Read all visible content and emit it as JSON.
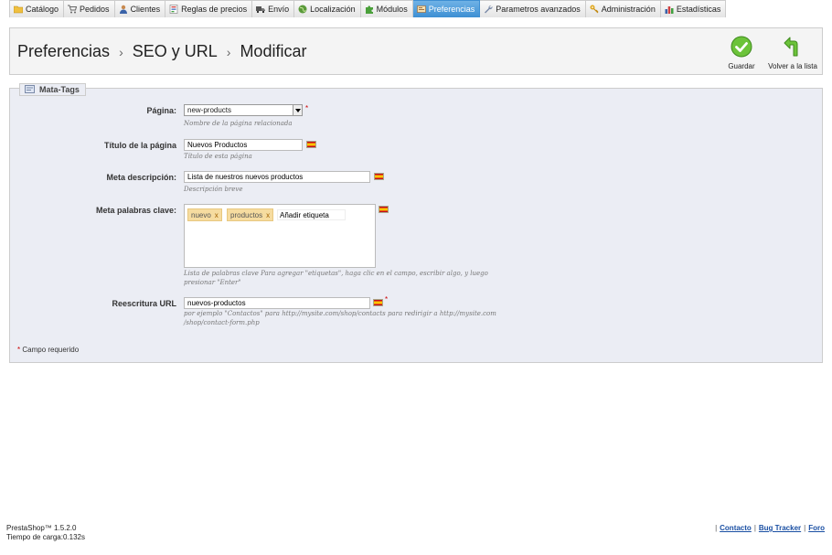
{
  "nav": {
    "tabs": [
      {
        "label": "Catálogo",
        "icon": "folder-icon"
      },
      {
        "label": "Pedidos",
        "icon": "cart-icon"
      },
      {
        "label": "Clientes",
        "icon": "user-icon"
      },
      {
        "label": "Reglas de precios",
        "icon": "price-rules-icon"
      },
      {
        "label": "Envío",
        "icon": "truck-icon"
      },
      {
        "label": "Localización",
        "icon": "globe-icon"
      },
      {
        "label": "Módulos",
        "icon": "puzzle-icon"
      },
      {
        "label": "Preferencias",
        "icon": "preferences-icon"
      },
      {
        "label": "Parametros avanzados",
        "icon": "wrench-icon"
      },
      {
        "label": "Administración",
        "icon": "key-icon"
      },
      {
        "label": "Estadísticas",
        "icon": "bar-chart-icon"
      }
    ],
    "active_index": 7
  },
  "header": {
    "breadcrumb": [
      "Preferencias",
      "SEO y URL",
      "Modificar"
    ],
    "separator": "›",
    "save_label": "Guardar",
    "back_label": "Volver a la lista"
  },
  "form": {
    "legend": "Mata-Tags",
    "page": {
      "label": "Página:",
      "value": "new-products",
      "hint": "Nombre de la página relacionada",
      "required_mark": "*"
    },
    "title": {
      "label": "Título de la página",
      "value": "Nuevos Productos",
      "hint": "Título de esta página"
    },
    "meta_description": {
      "label": "Meta descripción:",
      "value": "Lista de nuestros nuevos productos",
      "hint": "Descripción breve"
    },
    "meta_keywords": {
      "label": "Meta palabras clave:",
      "tags": [
        "nuevo",
        "productos"
      ],
      "tag_remove": "x",
      "add_placeholder": "Añadir etiqueta",
      "hint_line1": "Lista de palabras clave Para agregar \"etiquetas\", haga clic en el campo, escribir algo, y luego",
      "hint_line2": "presionar \"Enter\""
    },
    "rewrite_url": {
      "label": "Reescritura URL",
      "value": "nuevos-productos",
      "required_mark": "*",
      "hint_line1": "por ejemplo \"Contactos\" para http://mysite.com/shop/contacts para redirigir a http://mysite.com",
      "hint_line2": "/shop/contact-form.php"
    },
    "required_note_star": "*",
    "required_note": "Campo requerido"
  },
  "footer": {
    "version": "PrestaShop™ 1.5.2.0",
    "load_time": "Tiempo de carga:0.132s",
    "links": [
      "Contacto",
      "Bug Tracker",
      "Foro"
    ]
  },
  "colors": {
    "active_tab": "#3d8fd3",
    "panel_bg": "#ebedf4",
    "tag_bg": "#f6dca0",
    "link": "#1a4fa3"
  }
}
